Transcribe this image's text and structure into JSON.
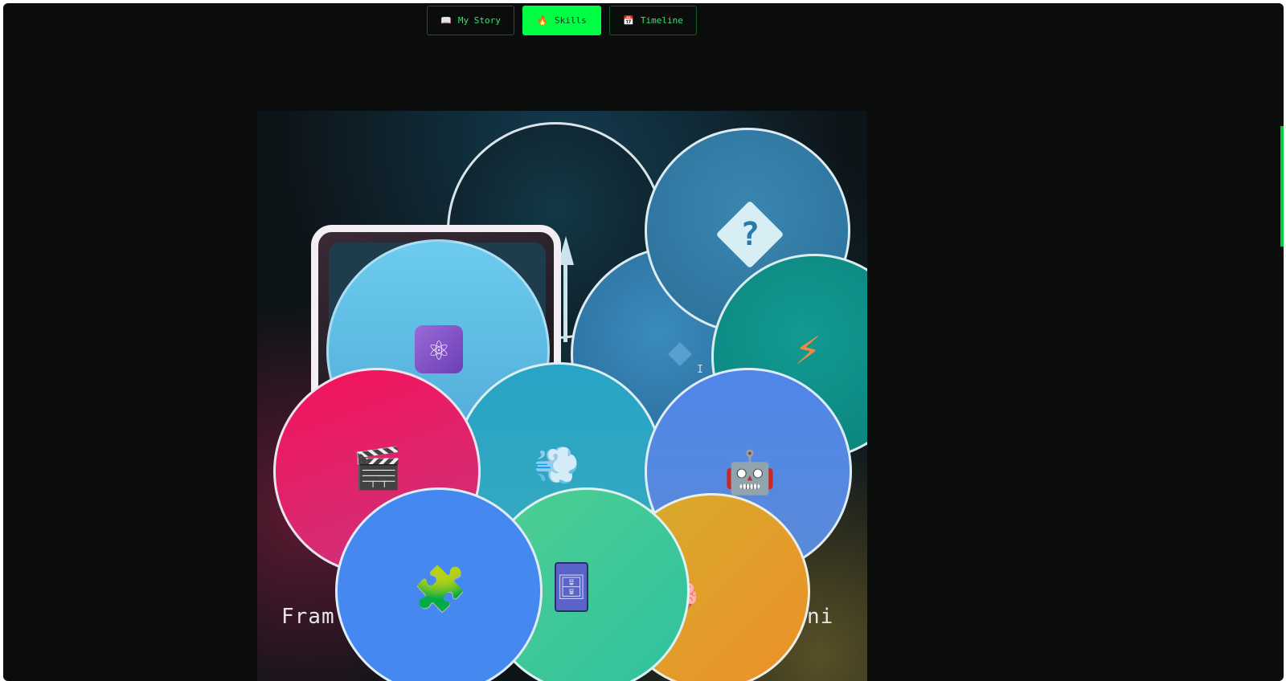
{
  "nav": {
    "tabs": [
      {
        "label": "My Story",
        "icon": "📖",
        "icon_name": "book-icon",
        "active": false
      },
      {
        "label": "Skills",
        "icon": "🔥",
        "icon_name": "flame-icon",
        "active": true
      },
      {
        "label": "Timeline",
        "icon": "📅",
        "icon_name": "calendar-icon",
        "active": false
      }
    ]
  },
  "skills": {
    "labels": {
      "left": "Fram",
      "right": "emini",
      "side_glyph": "I",
      "small_glyph": "I"
    },
    "bubbles": [
      {
        "icon": "?",
        "icon_name": "question-diamond-icon"
      },
      {
        "icon": "⚛",
        "icon_name": "atom-icon"
      },
      {
        "icon": "◆",
        "icon_name": "diamond-icon"
      },
      {
        "icon": "⚡",
        "icon_name": "lightning-icon"
      },
      {
        "icon": "🎬",
        "icon_name": "clapperboard-icon"
      },
      {
        "icon": "💨",
        "icon_name": "cloud-puff-icon"
      },
      {
        "icon": "🤖",
        "icon_name": "robot-icon"
      },
      {
        "icon": "🧩",
        "icon_name": "puzzle-piece-icon"
      },
      {
        "icon": "🗄",
        "icon_name": "file-cabinet-icon"
      },
      {
        "icon": "🧠",
        "icon_name": "brain-icon"
      }
    ]
  },
  "colors": {
    "accent": "#00ff44",
    "background": "#0b0c0c",
    "bubble_cyan": "#5cc8ec",
    "bubble_steel": "#2f7aa6",
    "bubble_teal": "#0a9a8e",
    "bubble_pink": "#ec1760",
    "bubble_blue": "#4a88e8",
    "bubble_green": "#3fc98f",
    "bubble_orange": "#e89a28"
  }
}
